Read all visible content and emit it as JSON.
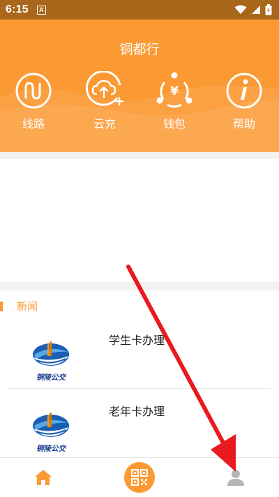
{
  "status_bar": {
    "time": "6:15",
    "notification_icon": "A",
    "icons": [
      "wifi-icon",
      "signal-icon",
      "battery-icon"
    ]
  },
  "header": {
    "title": "铜都行",
    "actions": [
      {
        "label": "线路",
        "icon": "route-icon"
      },
      {
        "label": "云充",
        "icon": "cloud-upload-icon"
      },
      {
        "label": "钱包",
        "icon": "wallet-yen-icon"
      },
      {
        "label": "帮助",
        "icon": "info-icon"
      }
    ]
  },
  "news": {
    "section_title": "新闻",
    "items": [
      {
        "title": "学生卡办理",
        "logo_text": "铜陵公交"
      },
      {
        "title": "老年卡办理",
        "logo_text": "铜陵公交"
      }
    ]
  },
  "bottom_nav": {
    "tabs": [
      {
        "name": "home",
        "icon": "home-icon",
        "active": true
      },
      {
        "name": "qr-code",
        "icon": "qr-code-icon"
      },
      {
        "name": "profile",
        "icon": "person-icon"
      }
    ]
  },
  "colors": {
    "accent": "#fb9a33",
    "status_bar": "#a8671b",
    "annotation_arrow": "#e8191f"
  }
}
